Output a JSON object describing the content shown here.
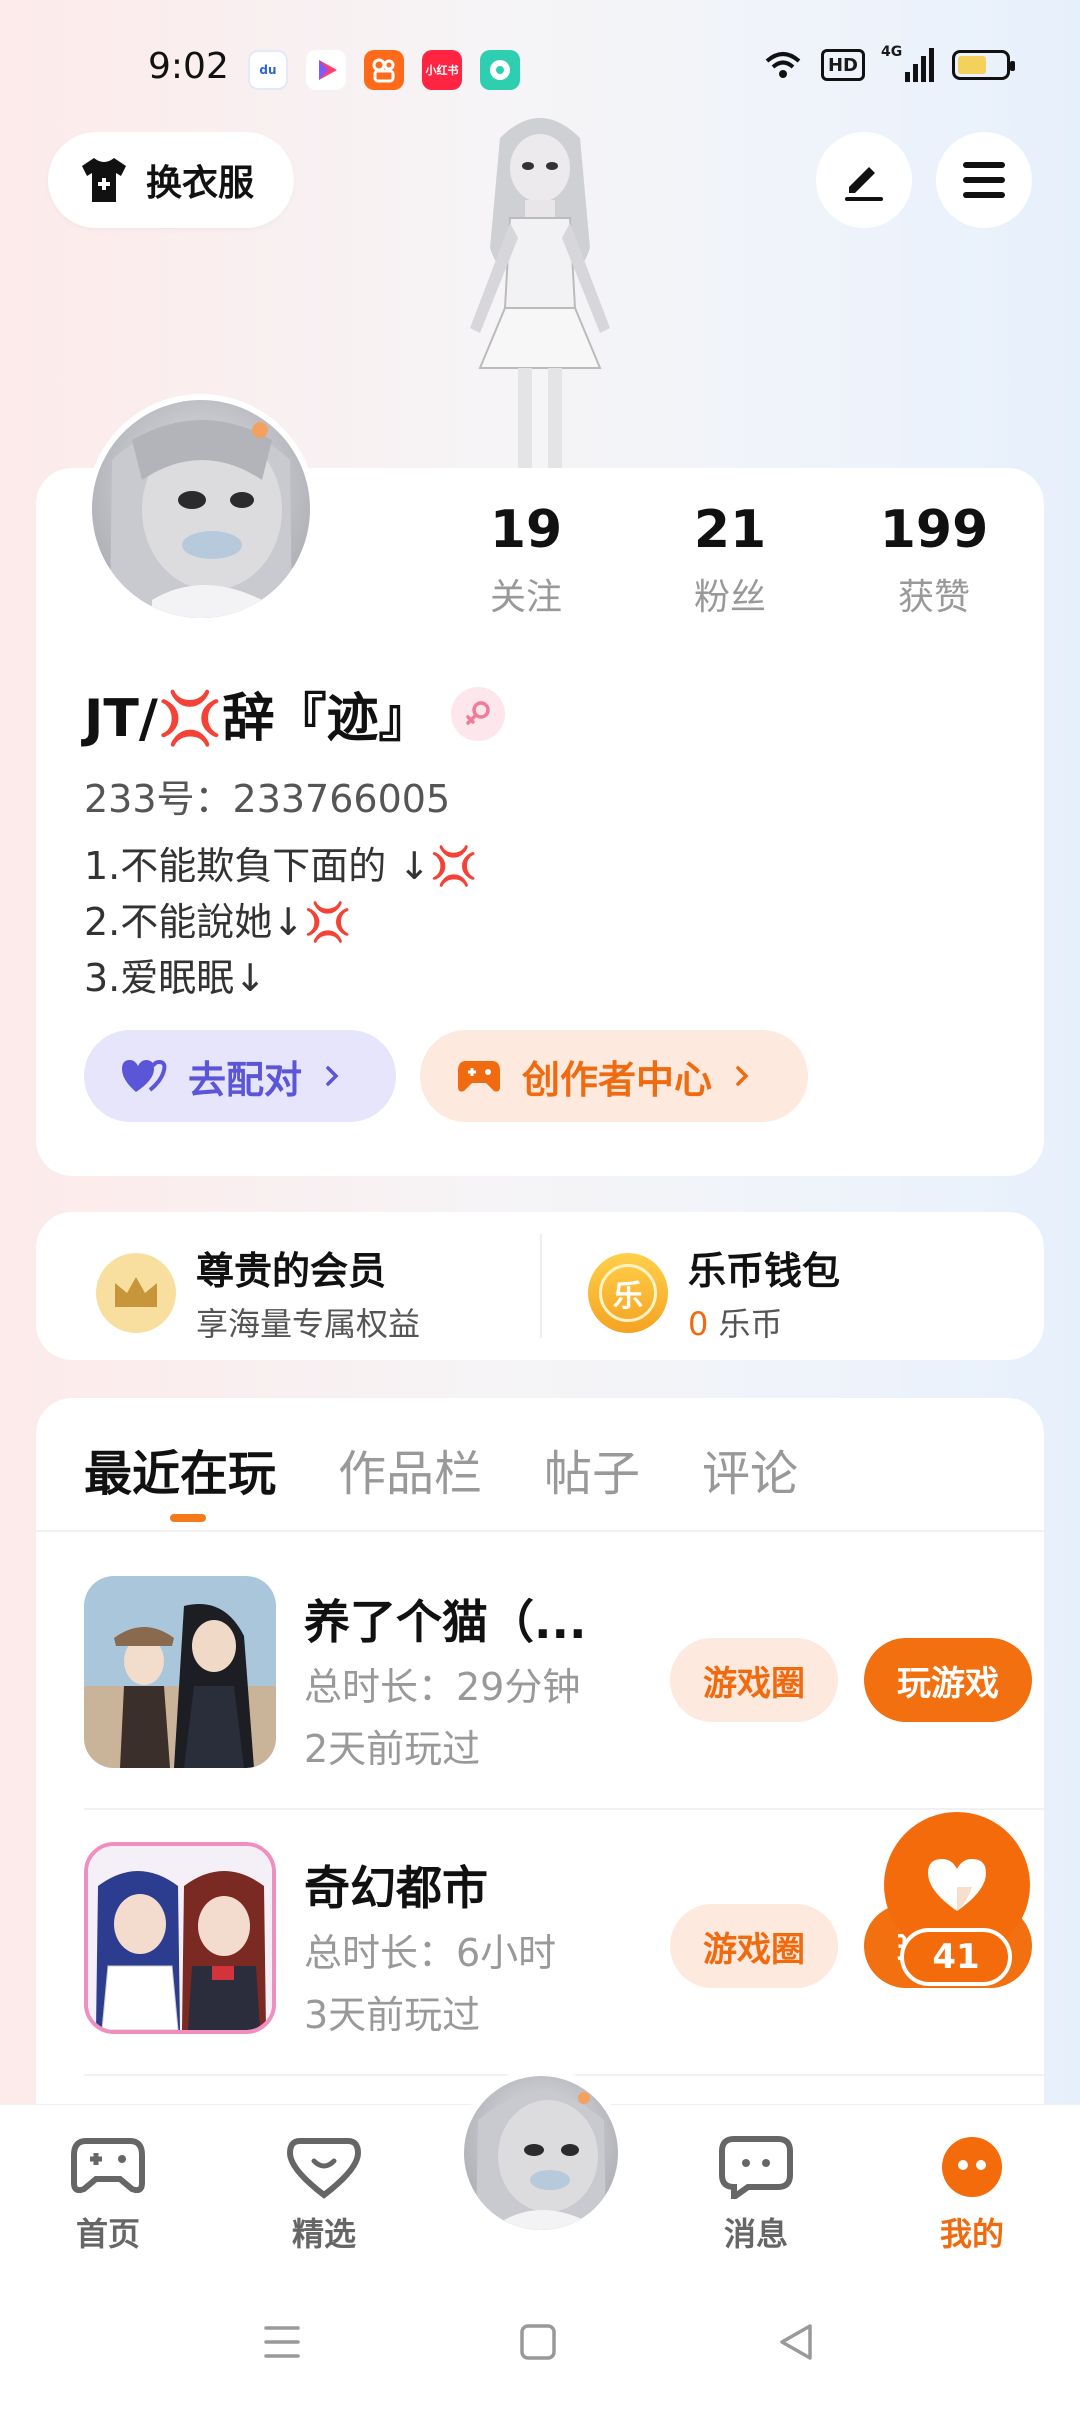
{
  "status_bar": {
    "time": "9:02",
    "notification_apps": [
      {
        "name": "baidu",
        "color": "#ffffff",
        "text": "du"
      },
      {
        "name": "video-app",
        "color": "#ffffff",
        "text": ""
      },
      {
        "name": "kuaishou",
        "color": "#ff6a1a",
        "text": ""
      },
      {
        "name": "xiaohongshu",
        "color": "#ff2442",
        "text": "小红书"
      },
      {
        "name": "chat-app",
        "color": "#2ecfb1",
        "text": ""
      }
    ],
    "hd_label": "HD",
    "network_label": "4G"
  },
  "top_controls": {
    "outfit_label": "换衣服"
  },
  "profile": {
    "username": "JT/💢辞『迹』",
    "uid": "233号：233766005",
    "bio": [
      "1.不能欺負下面的 ↓💢",
      "2.不能說她↓💢",
      "3.爱眠眠↓"
    ],
    "stats": [
      {
        "value": "19",
        "label": "关注"
      },
      {
        "value": "21",
        "label": "粉丝"
      },
      {
        "value": "199",
        "label": "获赞"
      }
    ],
    "match_label": "去配对",
    "creator_label": "创作者中心"
  },
  "membership": {
    "vip_title": "尊贵的会员",
    "vip_sub": "享海量专属权益",
    "wallet_title": "乐币钱包",
    "wallet_amount": "0",
    "wallet_unit": "乐币",
    "coin_char": "乐"
  },
  "tabs": [
    "最近在玩",
    "作品栏",
    "帖子",
    "评论"
  ],
  "games": [
    {
      "name": "养了个猫（...",
      "duration": "总时长：29分钟",
      "last_played": "2天前玩过",
      "circle_label": "游戏圈",
      "play_label": "玩游戏"
    },
    {
      "name": "奇幻都市",
      "duration": "总时长：6小时",
      "last_played": "3天前玩过",
      "circle_label": "游戏圈",
      "play_label": "玩游戏"
    }
  ],
  "like_fab": {
    "count": "41"
  },
  "bottom_nav": [
    {
      "label": "首页",
      "icon": "gamepad-icon",
      "active": false
    },
    {
      "label": "精选",
      "icon": "heart-chat-icon",
      "active": false
    },
    {
      "label": "消息",
      "icon": "message-icon",
      "active": false
    },
    {
      "label": "我的",
      "icon": "me-icon",
      "active": true
    }
  ],
  "colors": {
    "accent": "#f2700f",
    "match_purple": "#5b55d8"
  }
}
